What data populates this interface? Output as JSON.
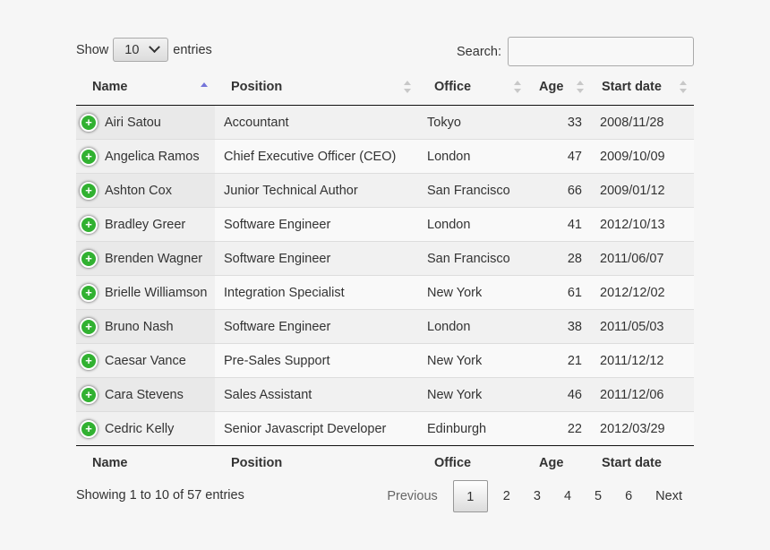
{
  "length": {
    "show_label": "Show",
    "value": "10",
    "entries_label": "entries"
  },
  "search": {
    "label": "Search:",
    "value": "",
    "placeholder": ""
  },
  "columns": [
    "Name",
    "Position",
    "Office",
    "Age",
    "Start date"
  ],
  "sort": {
    "column": "Name",
    "direction": "ascending"
  },
  "rows": [
    {
      "name": "Airi Satou",
      "position": "Accountant",
      "office": "Tokyo",
      "age": "33",
      "start": "2008/11/28"
    },
    {
      "name": "Angelica Ramos",
      "position": "Chief Executive Officer (CEO)",
      "office": "London",
      "age": "47",
      "start": "2009/10/09"
    },
    {
      "name": "Ashton Cox",
      "position": "Junior Technical Author",
      "office": "San Francisco",
      "age": "66",
      "start": "2009/01/12"
    },
    {
      "name": "Bradley Greer",
      "position": "Software Engineer",
      "office": "London",
      "age": "41",
      "start": "2012/10/13"
    },
    {
      "name": "Brenden Wagner",
      "position": "Software Engineer",
      "office": "San Francisco",
      "age": "28",
      "start": "2011/06/07"
    },
    {
      "name": "Brielle Williamson",
      "position": "Integration Specialist",
      "office": "New York",
      "age": "61",
      "start": "2012/12/02"
    },
    {
      "name": "Bruno Nash",
      "position": "Software Engineer",
      "office": "London",
      "age": "38",
      "start": "2011/05/03"
    },
    {
      "name": "Caesar Vance",
      "position": "Pre-Sales Support",
      "office": "New York",
      "age": "21",
      "start": "2011/12/12"
    },
    {
      "name": "Cara Stevens",
      "position": "Sales Assistant",
      "office": "New York",
      "age": "46",
      "start": "2011/12/06"
    },
    {
      "name": "Cedric Kelly",
      "position": "Senior Javascript Developer",
      "office": "Edinburgh",
      "age": "22",
      "start": "2012/03/29"
    }
  ],
  "expand_icon": "plus-circle-icon",
  "info": "Showing 1 to 10 of 57 entries",
  "pagination": {
    "previous": "Previous",
    "next": "Next",
    "pages": [
      "1",
      "2",
      "3",
      "4",
      "5",
      "6"
    ],
    "current": "1"
  }
}
